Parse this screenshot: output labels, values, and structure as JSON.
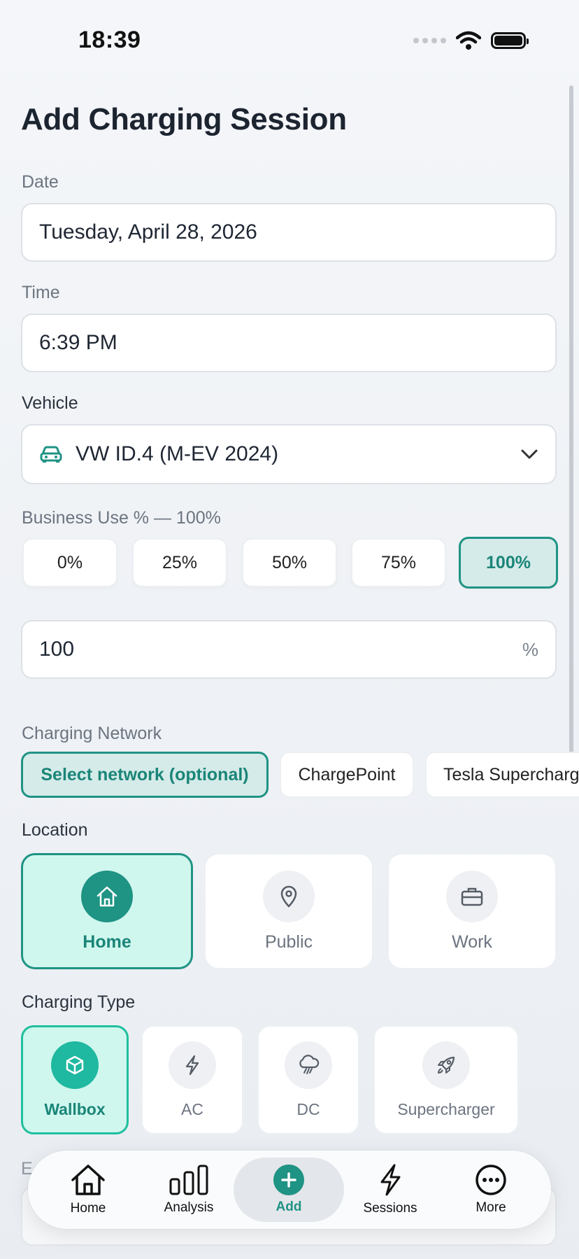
{
  "status_bar": {
    "time": "18:39"
  },
  "page": {
    "title": "Add Charging Session"
  },
  "date": {
    "label": "Date",
    "value": "Tuesday, April 28, 2026"
  },
  "time": {
    "label": "Time",
    "value": "6:39 PM"
  },
  "vehicle": {
    "label": "Vehicle",
    "value": "VW ID.4 (M-EV 2024)",
    "icon": "car-icon"
  },
  "business": {
    "label": "Business Use % — 100%",
    "options": [
      "0%",
      "25%",
      "50%",
      "75%",
      "100%"
    ],
    "selected": "100%",
    "input_value": "100",
    "unit": "%"
  },
  "network": {
    "label": "Charging Network",
    "options": [
      "Select network (optional)",
      "ChargePoint",
      "Tesla Supercharg"
    ],
    "selected": "Select network (optional)"
  },
  "location": {
    "label": "Location",
    "options": [
      {
        "label": "Home",
        "icon": "home-icon"
      },
      {
        "label": "Public",
        "icon": "map-pin-icon"
      },
      {
        "label": "Work",
        "icon": "briefcase-icon"
      }
    ],
    "selected": "Home"
  },
  "charging_type": {
    "label": "Charging Type",
    "options": [
      {
        "label": "Wallbox",
        "icon": "box-icon"
      },
      {
        "label": "AC",
        "icon": "bolt-icon"
      },
      {
        "label": "DC",
        "icon": "storm-icon"
      },
      {
        "label": "Supercharger",
        "icon": "rocket-icon"
      }
    ],
    "selected": "Wallbox"
  },
  "next_section": {
    "label": "E"
  },
  "tabbar": {
    "items": [
      {
        "label": "Home",
        "icon": "home-icon"
      },
      {
        "label": "Analysis",
        "icon": "bar-chart-icon"
      },
      {
        "label": "Add",
        "icon": "plus-icon"
      },
      {
        "label": "Sessions",
        "icon": "bolt-icon"
      },
      {
        "label": "More",
        "icon": "more-icon"
      }
    ],
    "active": "Add"
  },
  "colors": {
    "accent": "#1f9384",
    "accent_light": "#d5ebe9",
    "selected_card": "#cff7ee",
    "text": "#1f2733",
    "muted": "#6b7480"
  }
}
